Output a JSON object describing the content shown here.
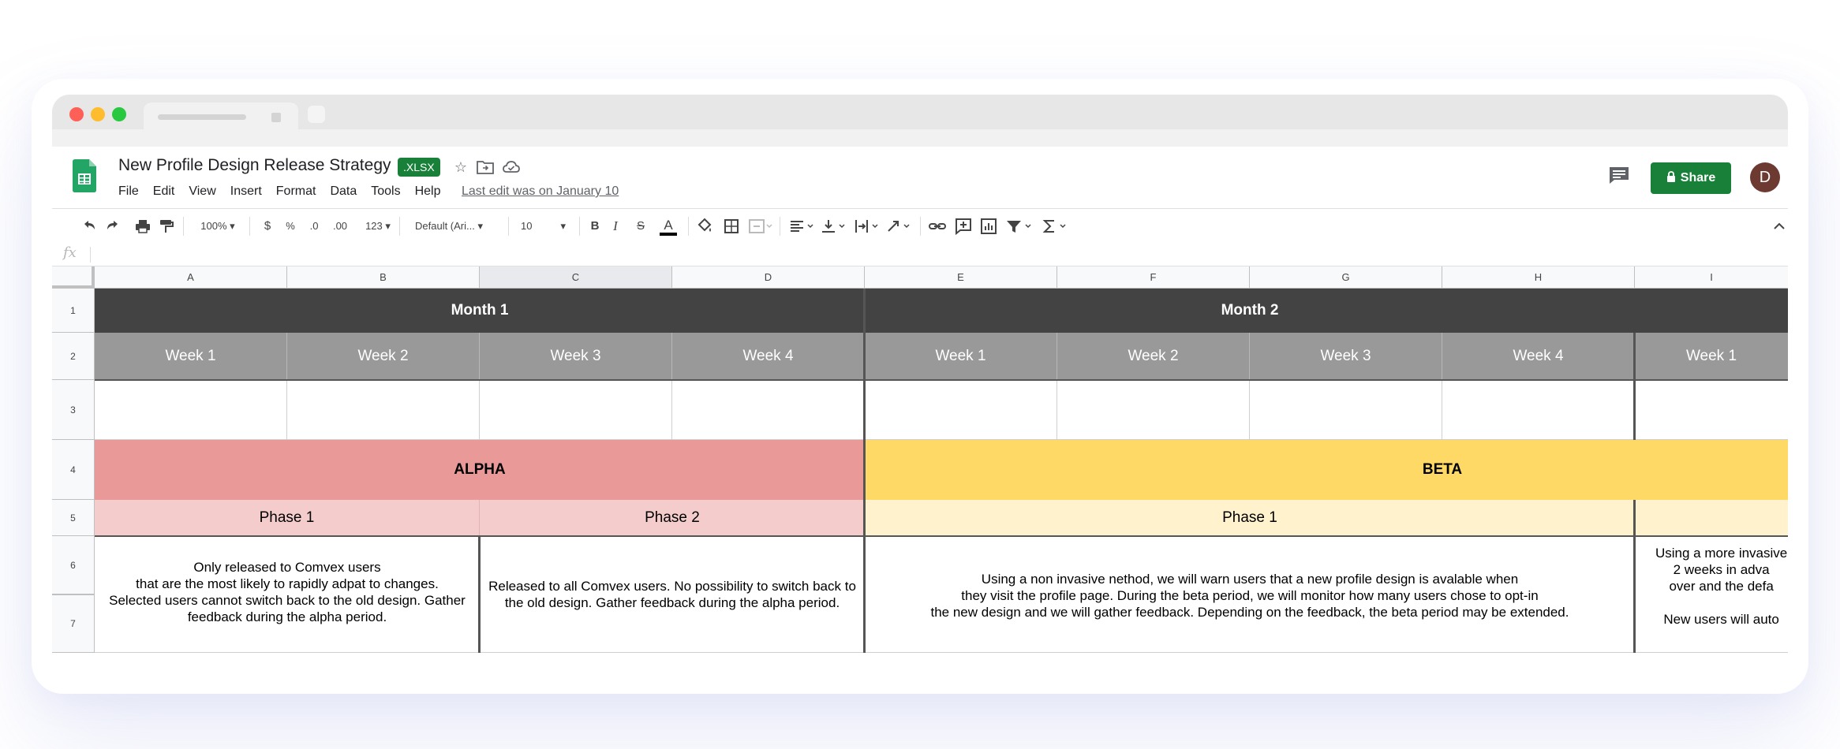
{
  "document": {
    "title": "New Profile Design Release Strategy",
    "format_badge": ".XLSX",
    "last_edit": "Last edit was on January 10"
  },
  "menu": [
    "File",
    "Edit",
    "View",
    "Insert",
    "Format",
    "Data",
    "Tools",
    "Help"
  ],
  "header": {
    "share_label": "Share",
    "avatar_initial": "D"
  },
  "toolbar": {
    "zoom": "100%",
    "currency": "$",
    "percent": "%",
    "decimal_decrease": ".0",
    "decimal_increase": ".00",
    "more_formats": "123",
    "font": "Default (Ari...",
    "font_size": "10",
    "bold": "B",
    "italic": "I",
    "strike": "S",
    "text_color": "A"
  },
  "formula_bar": {
    "fx": "fx",
    "value": ""
  },
  "columns": [
    "A",
    "B",
    "C",
    "D",
    "E",
    "F",
    "G",
    "H",
    "I"
  ],
  "rows": [
    "1",
    "2",
    "3",
    "4",
    "5",
    "6",
    "7"
  ],
  "sheet": {
    "month1": "Month 1",
    "month2": "Month 2",
    "weeks": [
      "Week 1",
      "Week 2",
      "Week 3",
      "Week 4",
      "Week 1",
      "Week 2",
      "Week 3",
      "Week 4",
      "Week 1"
    ],
    "alpha": "ALPHA",
    "beta": "BETA",
    "alpha_phase1": "Phase 1",
    "alpha_phase2": "Phase 2",
    "beta_phase1": "Phase 1",
    "alpha_phase1_desc": "Only released to Comvex users\nthat are the most likely to rapidly adpat to changes.\nSelected users cannot switch back to the old design. Gather\nfeedback during the alpha period.",
    "alpha_phase2_desc": "Released to all Comvex users. No possibility to switch back to\nthe old design. Gather feedback during the alpha period.",
    "beta_phase1_desc": "Using a non invasive nethod, we will warn users that a new profile design is avalable when\nthey visit the profile page. During the beta period, we will monitor how many users chose to opt-in\nthe new design and we will gather feedback. Depending on the feedback, the beta period may be extended.",
    "beta_phase2_desc": "Using a more invasive\n2 weeks in adva\nover and the defa\n\nNew users will auto"
  }
}
